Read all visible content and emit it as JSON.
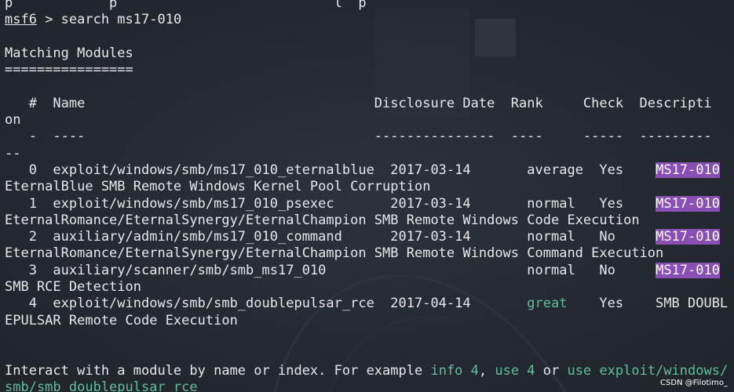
{
  "terminal": {
    "clipped_top": "p            p                           l  p",
    "prompt_name": "msf6",
    "prompt_rest": " > search ms17-010",
    "heading": "Matching Modules",
    "heading_rule": "================",
    "header_line1": "   #  Name                                    Disclosure Date  Rank     Check  Descripti",
    "header_line2": "on",
    "sep_line1": "   -  ----                                    ---------------  ----     -----  ---------",
    "sep_line2": "--",
    "rows": [
      {
        "prefix": "   0  exploit/windows/smb/ms17_010_eternalblue  2017-03-14       ",
        "rank": "average",
        "mid": "  ",
        "check": "Yes",
        "gap": "    ",
        "desc_hl": "MS17-010",
        "wrap": "EternalBlue SMB Remote Windows Kernel Pool Corruption"
      },
      {
        "prefix": "   1  exploit/windows/smb/ms17_010_psexec       2017-03-14       ",
        "rank": "normal",
        "mid": "   ",
        "check": "Yes",
        "gap": "    ",
        "desc_hl": "MS17-010",
        "wrap": "EternalRomance/EternalSynergy/EternalChampion SMB Remote Windows Code Execution"
      },
      {
        "prefix": "   2  auxiliary/admin/smb/ms17_010_command      2017-03-14       ",
        "rank": "normal",
        "mid": "   ",
        "check": "No",
        "gap": "     ",
        "desc_hl": "MS17-010",
        "wrap": "EternalRomance/EternalSynergy/EternalChampion SMB Remote Windows Command Execution"
      },
      {
        "prefix": "   3  auxiliary/scanner/smb/smb_ms17_010                         ",
        "rank": "normal",
        "mid": "   ",
        "check": "No",
        "gap": "     ",
        "desc_hl": "MS17-010",
        "wrap": "SMB RCE Detection"
      }
    ],
    "row4_prefix": "   4  exploit/windows/smb/smb_doublepulsar_rce  2017-04-14       ",
    "row4_rank": "great",
    "row4_rest": "    Yes    SMB DOUBL",
    "row4_wrap": "EPULSAR Remote Code Execution",
    "interact_a": "Interact with a module by name or index. For example ",
    "interact_info": "info 4",
    "interact_comma": ", ",
    "interact_use4": "use 4",
    "interact_or": " or ",
    "interact_use_path": "use exploit/windows/",
    "interact_wrap": "smb/smb_doublepulsar_rce"
  },
  "watermark": "CSDN @Filotimo_",
  "colors": {
    "background": "#252a33",
    "text": "#e6e8ea",
    "highlight_bg": "#8a4fb5",
    "green": "#5fbf9a"
  }
}
